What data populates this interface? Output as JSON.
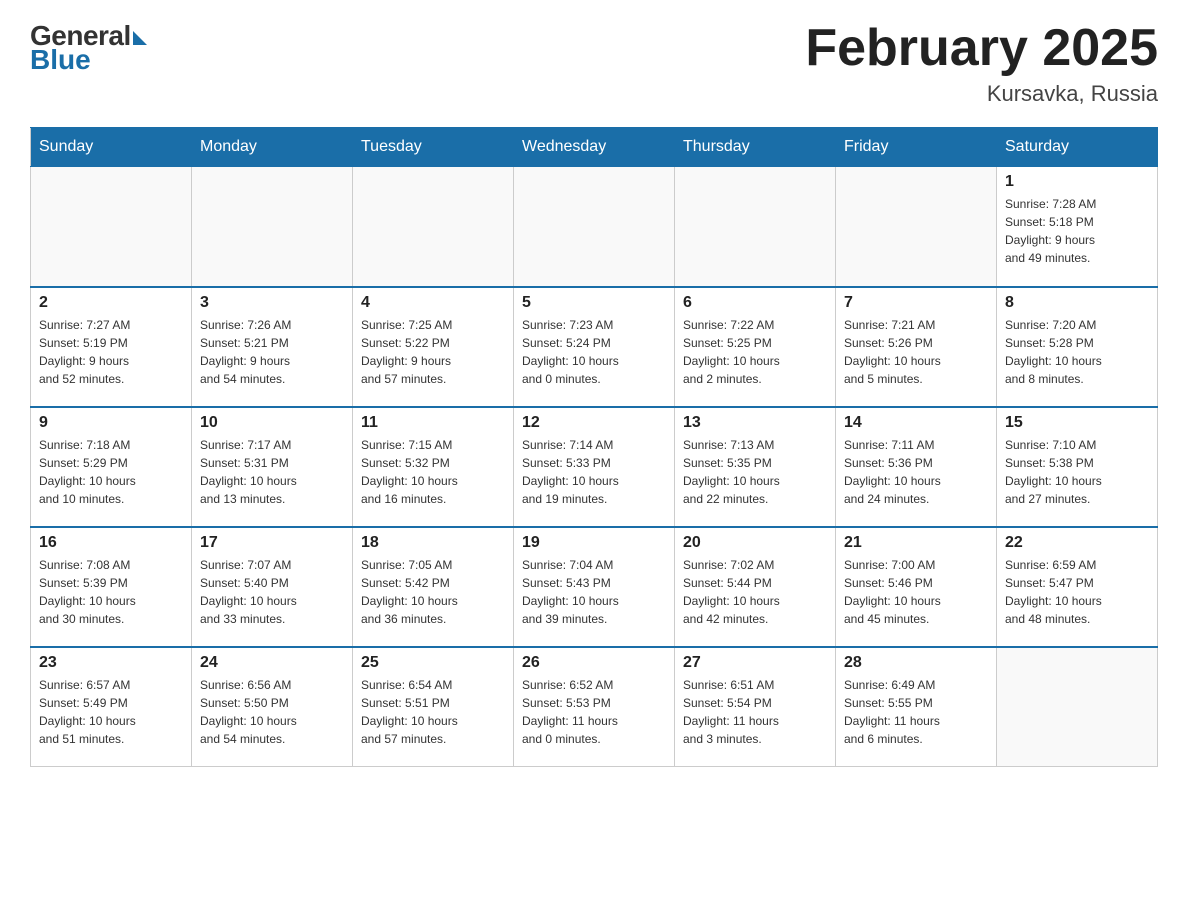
{
  "header": {
    "logo": {
      "general": "General",
      "blue": "Blue"
    },
    "title": "February 2025",
    "subtitle": "Kursavka, Russia"
  },
  "days_of_week": [
    "Sunday",
    "Monday",
    "Tuesday",
    "Wednesday",
    "Thursday",
    "Friday",
    "Saturday"
  ],
  "weeks": [
    [
      {
        "day": "",
        "info": ""
      },
      {
        "day": "",
        "info": ""
      },
      {
        "day": "",
        "info": ""
      },
      {
        "day": "",
        "info": ""
      },
      {
        "day": "",
        "info": ""
      },
      {
        "day": "",
        "info": ""
      },
      {
        "day": "1",
        "info": "Sunrise: 7:28 AM\nSunset: 5:18 PM\nDaylight: 9 hours\nand 49 minutes."
      }
    ],
    [
      {
        "day": "2",
        "info": "Sunrise: 7:27 AM\nSunset: 5:19 PM\nDaylight: 9 hours\nand 52 minutes."
      },
      {
        "day": "3",
        "info": "Sunrise: 7:26 AM\nSunset: 5:21 PM\nDaylight: 9 hours\nand 54 minutes."
      },
      {
        "day": "4",
        "info": "Sunrise: 7:25 AM\nSunset: 5:22 PM\nDaylight: 9 hours\nand 57 minutes."
      },
      {
        "day": "5",
        "info": "Sunrise: 7:23 AM\nSunset: 5:24 PM\nDaylight: 10 hours\nand 0 minutes."
      },
      {
        "day": "6",
        "info": "Sunrise: 7:22 AM\nSunset: 5:25 PM\nDaylight: 10 hours\nand 2 minutes."
      },
      {
        "day": "7",
        "info": "Sunrise: 7:21 AM\nSunset: 5:26 PM\nDaylight: 10 hours\nand 5 minutes."
      },
      {
        "day": "8",
        "info": "Sunrise: 7:20 AM\nSunset: 5:28 PM\nDaylight: 10 hours\nand 8 minutes."
      }
    ],
    [
      {
        "day": "9",
        "info": "Sunrise: 7:18 AM\nSunset: 5:29 PM\nDaylight: 10 hours\nand 10 minutes."
      },
      {
        "day": "10",
        "info": "Sunrise: 7:17 AM\nSunset: 5:31 PM\nDaylight: 10 hours\nand 13 minutes."
      },
      {
        "day": "11",
        "info": "Sunrise: 7:15 AM\nSunset: 5:32 PM\nDaylight: 10 hours\nand 16 minutes."
      },
      {
        "day": "12",
        "info": "Sunrise: 7:14 AM\nSunset: 5:33 PM\nDaylight: 10 hours\nand 19 minutes."
      },
      {
        "day": "13",
        "info": "Sunrise: 7:13 AM\nSunset: 5:35 PM\nDaylight: 10 hours\nand 22 minutes."
      },
      {
        "day": "14",
        "info": "Sunrise: 7:11 AM\nSunset: 5:36 PM\nDaylight: 10 hours\nand 24 minutes."
      },
      {
        "day": "15",
        "info": "Sunrise: 7:10 AM\nSunset: 5:38 PM\nDaylight: 10 hours\nand 27 minutes."
      }
    ],
    [
      {
        "day": "16",
        "info": "Sunrise: 7:08 AM\nSunset: 5:39 PM\nDaylight: 10 hours\nand 30 minutes."
      },
      {
        "day": "17",
        "info": "Sunrise: 7:07 AM\nSunset: 5:40 PM\nDaylight: 10 hours\nand 33 minutes."
      },
      {
        "day": "18",
        "info": "Sunrise: 7:05 AM\nSunset: 5:42 PM\nDaylight: 10 hours\nand 36 minutes."
      },
      {
        "day": "19",
        "info": "Sunrise: 7:04 AM\nSunset: 5:43 PM\nDaylight: 10 hours\nand 39 minutes."
      },
      {
        "day": "20",
        "info": "Sunrise: 7:02 AM\nSunset: 5:44 PM\nDaylight: 10 hours\nand 42 minutes."
      },
      {
        "day": "21",
        "info": "Sunrise: 7:00 AM\nSunset: 5:46 PM\nDaylight: 10 hours\nand 45 minutes."
      },
      {
        "day": "22",
        "info": "Sunrise: 6:59 AM\nSunset: 5:47 PM\nDaylight: 10 hours\nand 48 minutes."
      }
    ],
    [
      {
        "day": "23",
        "info": "Sunrise: 6:57 AM\nSunset: 5:49 PM\nDaylight: 10 hours\nand 51 minutes."
      },
      {
        "day": "24",
        "info": "Sunrise: 6:56 AM\nSunset: 5:50 PM\nDaylight: 10 hours\nand 54 minutes."
      },
      {
        "day": "25",
        "info": "Sunrise: 6:54 AM\nSunset: 5:51 PM\nDaylight: 10 hours\nand 57 minutes."
      },
      {
        "day": "26",
        "info": "Sunrise: 6:52 AM\nSunset: 5:53 PM\nDaylight: 11 hours\nand 0 minutes."
      },
      {
        "day": "27",
        "info": "Sunrise: 6:51 AM\nSunset: 5:54 PM\nDaylight: 11 hours\nand 3 minutes."
      },
      {
        "day": "28",
        "info": "Sunrise: 6:49 AM\nSunset: 5:55 PM\nDaylight: 11 hours\nand 6 minutes."
      },
      {
        "day": "",
        "info": ""
      }
    ]
  ]
}
